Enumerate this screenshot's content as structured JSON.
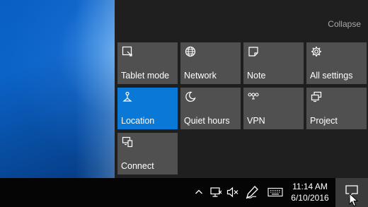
{
  "action_center": {
    "collapse_label": "Collapse",
    "accent_color": "#0a78d7",
    "tiles": [
      {
        "label": "Tablet mode",
        "icon": "tablet-mode-icon",
        "active": false
      },
      {
        "label": "Network",
        "icon": "globe-icon",
        "active": false
      },
      {
        "label": "Note",
        "icon": "note-icon",
        "active": false
      },
      {
        "label": "All settings",
        "icon": "gear-icon",
        "active": false
      },
      {
        "label": "Location",
        "icon": "location-icon",
        "active": true
      },
      {
        "label": "Quiet hours",
        "icon": "moon-icon",
        "active": false
      },
      {
        "label": "VPN",
        "icon": "vpn-icon",
        "active": false
      },
      {
        "label": "Project",
        "icon": "project-icon",
        "active": false
      },
      {
        "label": "Connect",
        "icon": "connect-icon",
        "active": false
      }
    ]
  },
  "taskbar": {
    "tray_icons": [
      "chevron-up-icon",
      "network-icon",
      "volume-muted-icon",
      "pen-icon",
      "keyboard-icon"
    ],
    "clock": {
      "time": "11:14 AM",
      "date": "6/10/2016"
    },
    "action_center_icon": "action-center-icon"
  }
}
